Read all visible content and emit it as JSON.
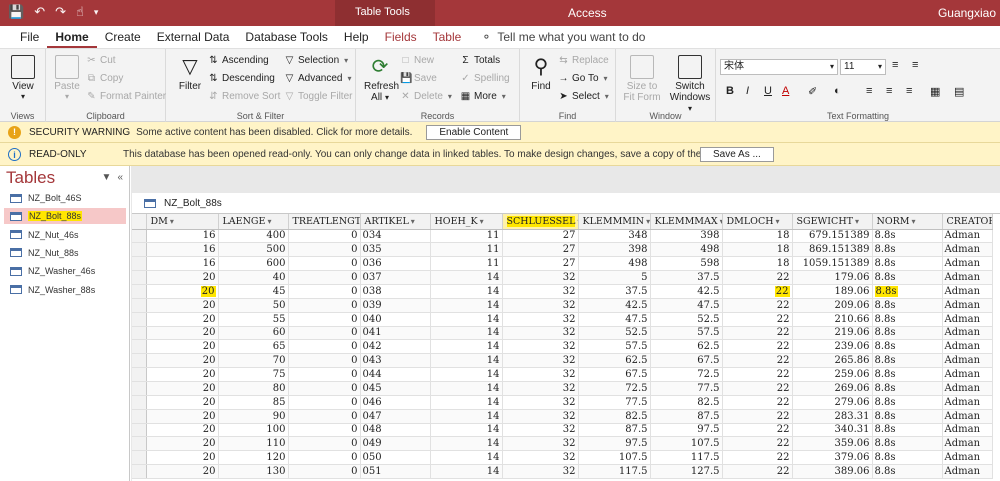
{
  "titlebar": {
    "context_label": "Table Tools",
    "app_name": "Access",
    "user": "Guangxiao"
  },
  "tabs": [
    {
      "label": "File",
      "active": false,
      "contextual": false
    },
    {
      "label": "Home",
      "active": true,
      "contextual": false
    },
    {
      "label": "Create",
      "active": false,
      "contextual": false
    },
    {
      "label": "External Data",
      "active": false,
      "contextual": false
    },
    {
      "label": "Database Tools",
      "active": false,
      "contextual": false
    },
    {
      "label": "Help",
      "active": false,
      "contextual": false
    },
    {
      "label": "Fields",
      "active": false,
      "contextual": true
    },
    {
      "label": "Table",
      "active": false,
      "contextual": true
    }
  ],
  "tell_me": "Tell me what you want to do",
  "ribbon": {
    "views": {
      "view": "View",
      "group": "Views"
    },
    "clipboard": {
      "paste": "Paste",
      "cut": "Cut",
      "copy": "Copy",
      "format_painter": "Format Painter",
      "group": "Clipboard"
    },
    "sort_filter": {
      "filter": "Filter",
      "ascending": "Ascending",
      "descending": "Descending",
      "remove_sort": "Remove Sort",
      "selection": "Selection",
      "advanced": "Advanced",
      "toggle_filter": "Toggle Filter",
      "group": "Sort & Filter"
    },
    "records": {
      "refresh": "Refresh",
      "refresh2": "All",
      "new": "New",
      "save": "Save",
      "delete": "Delete",
      "totals": "Totals",
      "spelling": "Spelling",
      "more": "More",
      "group": "Records"
    },
    "find": {
      "find": "Find",
      "replace": "Replace",
      "goto": "Go To",
      "select": "Select",
      "group": "Find"
    },
    "window": {
      "size_to_fit": "Size to",
      "size_to_fit2": "Fit Form",
      "switch": "Switch",
      "switch2": "Windows",
      "group": "Window"
    },
    "text_formatting": {
      "font": "宋体",
      "size": "11",
      "group": "Text Formatting"
    }
  },
  "security_bar": {
    "title": "SECURITY WARNING",
    "message": "Some active content has been disabled. Click for more details.",
    "button": "Enable Content"
  },
  "readonly_bar": {
    "title": "READ-ONLY",
    "message": "This database has been opened read-only. You can only change data in linked tables. To make design changes, save a copy of the database.",
    "button": "Save As ..."
  },
  "nav": {
    "header": "Tables",
    "items": [
      {
        "label": "NZ_Bolt_46S",
        "selected": false
      },
      {
        "label": "NZ_Bolt_88s",
        "selected": true
      },
      {
        "label": "NZ_Nut_46s",
        "selected": false
      },
      {
        "label": "NZ_Nut_88s",
        "selected": false
      },
      {
        "label": "NZ_Washer_46s",
        "selected": false
      },
      {
        "label": "NZ_Washer_88s",
        "selected": false
      }
    ]
  },
  "document_tab": "NZ_Bolt_88s",
  "grid": {
    "columns": [
      "DM",
      "LAENGE",
      "TREATLENGT",
      "ARTIKEL",
      "HOEH_K",
      "SCHLUESSEL",
      "KLEMMMIN",
      "KLEMMMAX",
      "DMLOCH",
      "SGEWICHT",
      "NORM",
      "CREATOR"
    ],
    "sorted_column": "SCHLUESSEL",
    "rows": [
      [
        "16",
        "400",
        "0",
        "034",
        "11",
        "27",
        "348",
        "398",
        "18",
        "679.151389",
        "8.8s",
        "Adman"
      ],
      [
        "16",
        "500",
        "0",
        "035",
        "11",
        "27",
        "398",
        "498",
        "18",
        "869.151389",
        "8.8s",
        "Adman"
      ],
      [
        "16",
        "600",
        "0",
        "036",
        "11",
        "27",
        "498",
        "598",
        "18",
        "1059.151389",
        "8.8s",
        "Adman"
      ],
      [
        "20",
        "40",
        "0",
        "037",
        "14",
        "32",
        "5",
        "37.5",
        "22",
        "179.06",
        "8.8s",
        "Adman"
      ],
      [
        "20",
        "45",
        "0",
        "038",
        "14",
        "32",
        "37.5",
        "42.5",
        "22",
        "189.06",
        "8.8s",
        "Adman"
      ],
      [
        "20",
        "50",
        "0",
        "039",
        "14",
        "32",
        "42.5",
        "47.5",
        "22",
        "209.06",
        "8.8s",
        "Adman"
      ],
      [
        "20",
        "55",
        "0",
        "040",
        "14",
        "32",
        "47.5",
        "52.5",
        "22",
        "210.66",
        "8.8s",
        "Adman"
      ],
      [
        "20",
        "60",
        "0",
        "041",
        "14",
        "32",
        "52.5",
        "57.5",
        "22",
        "219.06",
        "8.8s",
        "Adman"
      ],
      [
        "20",
        "65",
        "0",
        "042",
        "14",
        "32",
        "57.5",
        "62.5",
        "22",
        "239.06",
        "8.8s",
        "Adman"
      ],
      [
        "20",
        "70",
        "0",
        "043",
        "14",
        "32",
        "62.5",
        "67.5",
        "22",
        "265.86",
        "8.8s",
        "Adman"
      ],
      [
        "20",
        "75",
        "0",
        "044",
        "14",
        "32",
        "67.5",
        "72.5",
        "22",
        "259.06",
        "8.8s",
        "Adman"
      ],
      [
        "20",
        "80",
        "0",
        "045",
        "14",
        "32",
        "72.5",
        "77.5",
        "22",
        "269.06",
        "8.8s",
        "Adman"
      ],
      [
        "20",
        "85",
        "0",
        "046",
        "14",
        "32",
        "77.5",
        "82.5",
        "22",
        "279.06",
        "8.8s",
        "Adman"
      ],
      [
        "20",
        "90",
        "0",
        "047",
        "14",
        "32",
        "82.5",
        "87.5",
        "22",
        "283.31",
        "8.8s",
        "Adman"
      ],
      [
        "20",
        "100",
        "0",
        "048",
        "14",
        "32",
        "87.5",
        "97.5",
        "22",
        "340.31",
        "8.8s",
        "Adman"
      ],
      [
        "20",
        "110",
        "0",
        "049",
        "14",
        "32",
        "97.5",
        "107.5",
        "22",
        "359.06",
        "8.8s",
        "Adman"
      ],
      [
        "20",
        "120",
        "0",
        "050",
        "14",
        "32",
        "107.5",
        "117.5",
        "22",
        "379.06",
        "8.8s",
        "Adman"
      ],
      [
        "20",
        "130",
        "0",
        "051",
        "14",
        "32",
        "117.5",
        "127.5",
        "22",
        "389.06",
        "8.8s",
        "Adman"
      ]
    ],
    "highlight": {
      "row": 4,
      "cols": [
        0,
        8,
        10
      ]
    }
  },
  "colors": {
    "accent": "#a4373a",
    "highlight": "#ffe600",
    "warning_bg": "#fff4c7"
  }
}
